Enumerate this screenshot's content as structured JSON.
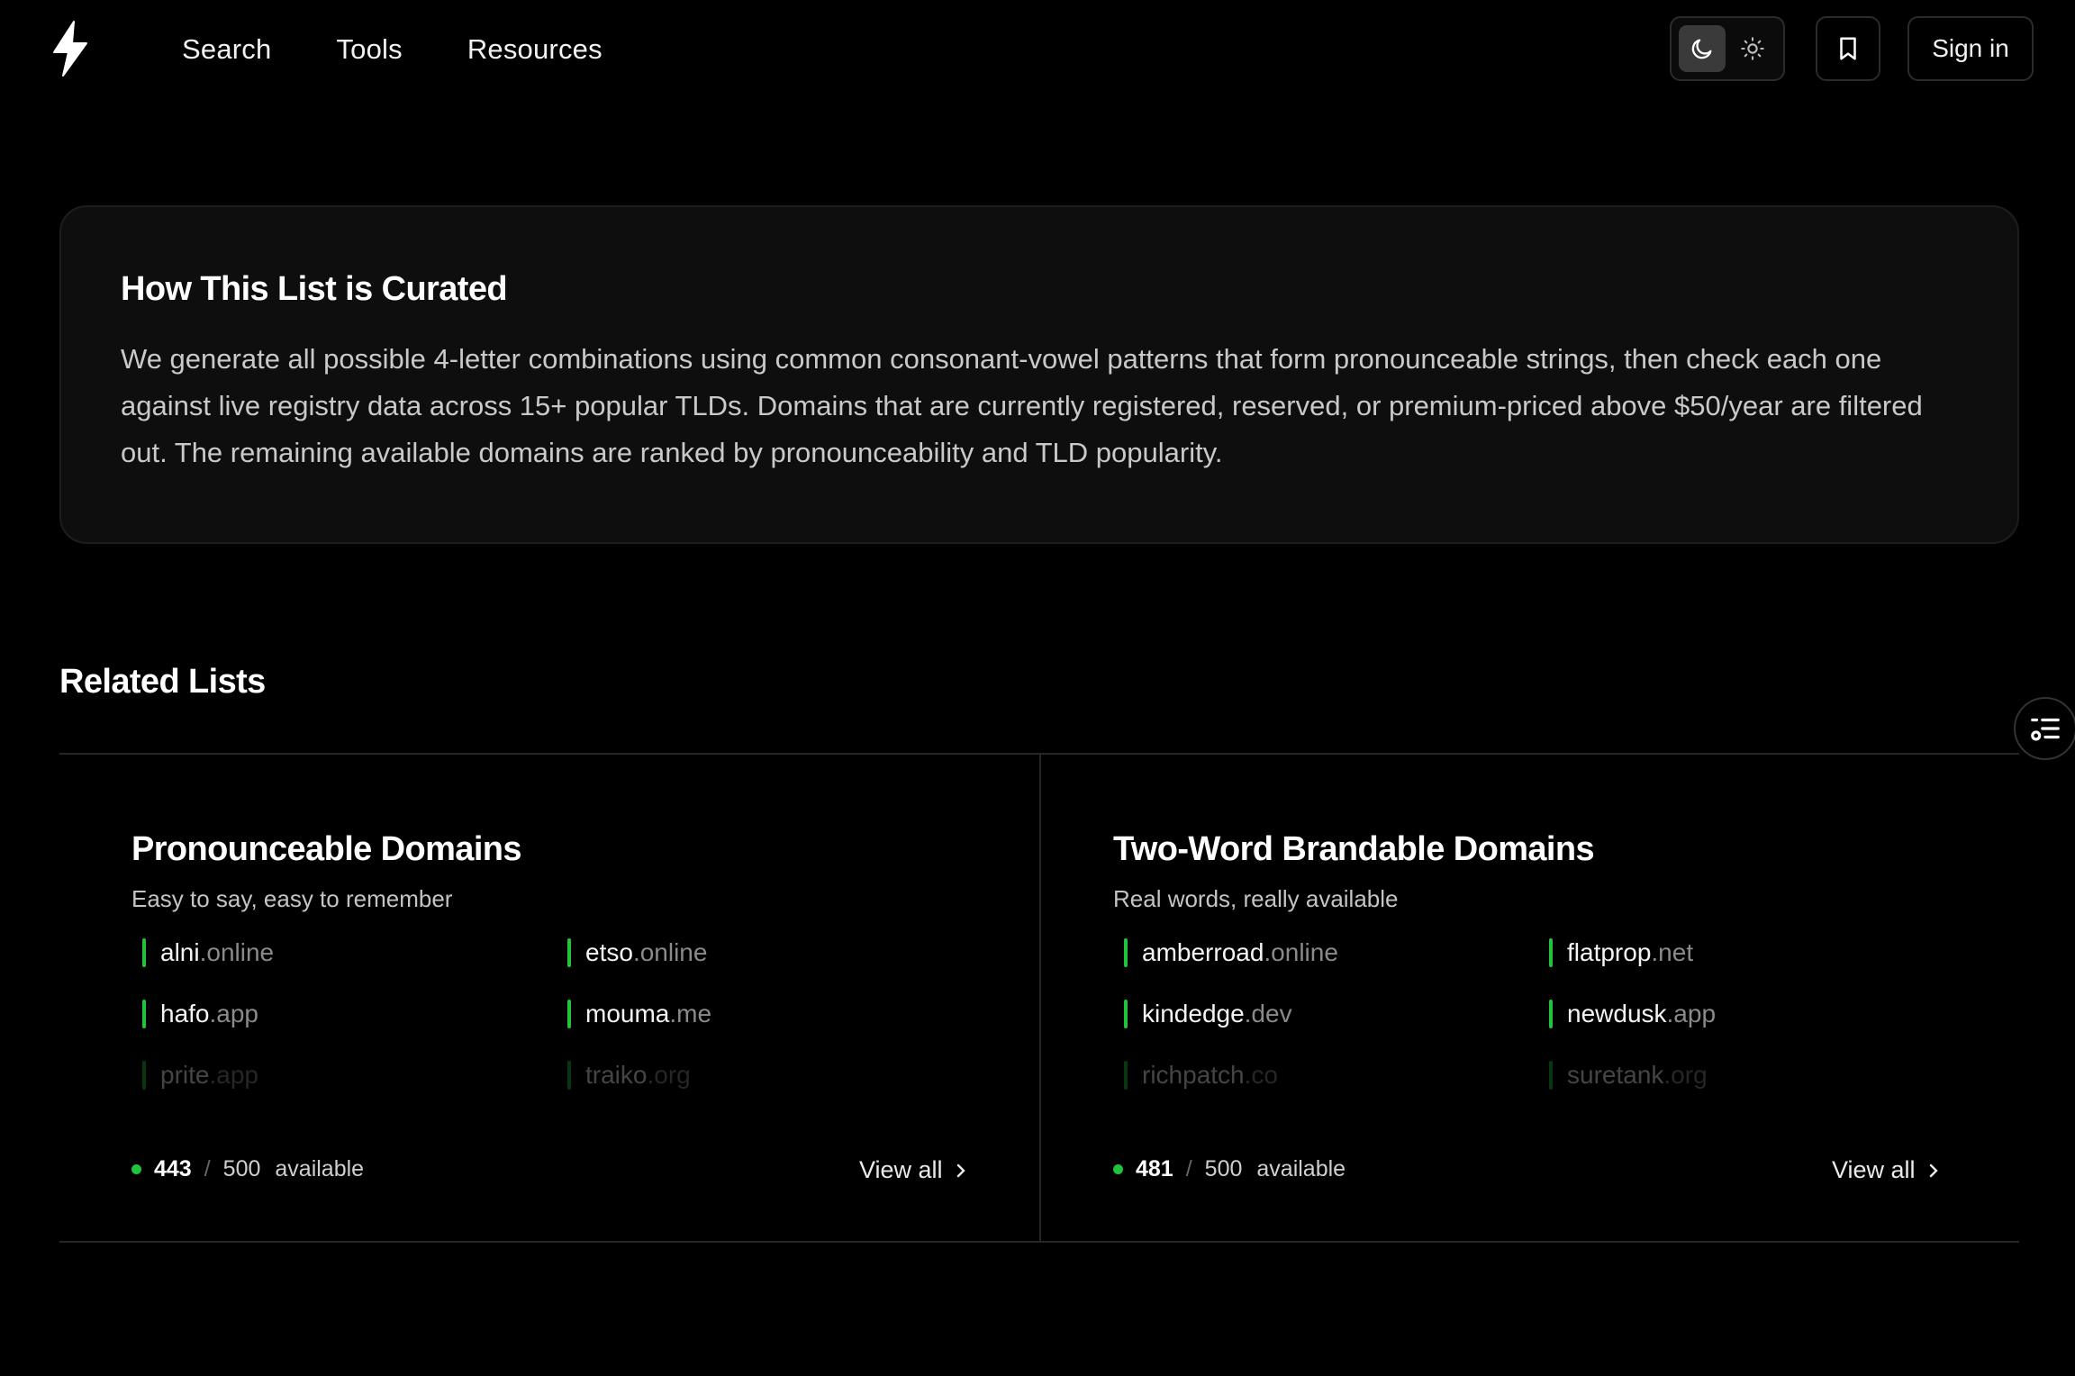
{
  "nav": {
    "links": [
      "Search",
      "Tools",
      "Resources"
    ],
    "sign_in": "Sign in"
  },
  "curated": {
    "title": "How This List is Curated",
    "body": "We generate all possible 4-letter combinations using common consonant-vowel patterns that form pronounceable strings, then check each one against live registry data across 15+ popular TLDs. Domains that are currently registered, reserved, or premium-priced above $50/year are filtered out. The remaining available domains are ranked by pronounceability and TLD popularity."
  },
  "related": {
    "title": "Related Lists",
    "lists": [
      {
        "title": "Pronounceable Domains",
        "subtitle": "Easy to say, easy to remember",
        "domains": [
          {
            "name": "alni",
            "tld": ".online"
          },
          {
            "name": "etso",
            "tld": ".online"
          },
          {
            "name": "hafo",
            "tld": ".app"
          },
          {
            "name": "mouma",
            "tld": ".me"
          },
          {
            "name": "prite",
            "tld": ".app"
          },
          {
            "name": "traiko",
            "tld": ".org"
          }
        ],
        "available": "443",
        "separator": "/",
        "total": "500",
        "available_label": "available",
        "view_all": "View all"
      },
      {
        "title": "Two-Word Brandable Domains",
        "subtitle": "Real words, really available",
        "domains": [
          {
            "name": "amberroad",
            "tld": ".online"
          },
          {
            "name": "flatprop",
            "tld": ".net"
          },
          {
            "name": "kindedge",
            "tld": ".dev"
          },
          {
            "name": "newdusk",
            "tld": ".app"
          },
          {
            "name": "richpatch",
            "tld": ".co"
          },
          {
            "name": "suretank",
            "tld": ".org"
          }
        ],
        "available": "481",
        "separator": "/",
        "total": "500",
        "available_label": "available",
        "view_all": "View all"
      }
    ]
  },
  "colors": {
    "background": "#000000",
    "accent_green": "#22c33a",
    "card": "#0e0e0e"
  },
  "icons": [
    "bolt-logo-icon",
    "moon-icon",
    "sun-icon",
    "bookmark-icon",
    "toc-list-icon",
    "chevron-right-icon"
  ]
}
